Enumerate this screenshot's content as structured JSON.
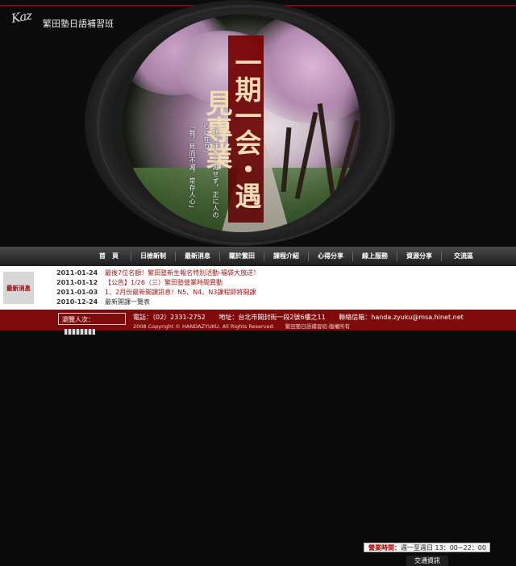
{
  "header": {
    "logo_mark": "Kaz",
    "logo_text": "繁田塾日語補習班"
  },
  "hero": {
    "title": "一期一会・遇見專業",
    "poem_line1": "「我，死して滅せず，正に人の心に在り」",
    "poem_line2": "「我，死而不滅，常存人心」"
  },
  "nav": {
    "items": [
      "首　頁",
      "日檢新制",
      "最新消息",
      "關於繁田",
      "課程介紹",
      "心得分享",
      "線上服務",
      "資源分享",
      "交流區"
    ]
  },
  "news": {
    "label": "最新消息",
    "items": [
      {
        "date": "2011-01-24",
        "title": "最後7位名額！繁田塾新生報名特別活動-福袋大放送！"
      },
      {
        "date": "2011-01-12",
        "title": "【公告】1/26（三）繁田塾營業時間異動"
      },
      {
        "date": "2011-01-03",
        "title": "1、2月份最新開課訊息！N5、N4、N3課程即將開課"
      },
      {
        "date": "2010-12-24",
        "title": "最新開課一覽表"
      }
    ]
  },
  "hours": {
    "label": "營業時間：",
    "value": "週一至週日 13：00~22：00",
    "traffic_button": "交通資訊"
  },
  "footer": {
    "visitors_label": "瀏覽人次：",
    "phone": "電話：（02）2331-2752",
    "address": "地址：台北市開封街一段2號6樓之11",
    "email": "聯絡信箱：handa.zyuku@msa.hinet.net",
    "copyright": "2008 Copyright © HANDAZYUKU. All Rights Reserved.　　繁田塾日語補習班-版權所有"
  },
  "colors": {
    "accent": "#7e0a0a",
    "news_title": "#a01818"
  }
}
